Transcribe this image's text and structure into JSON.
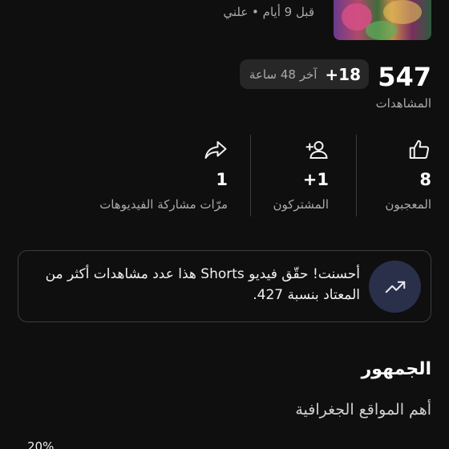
{
  "header": {
    "meta": "قبل 9 أيام • علني",
    "thumbnail": "video-thumbnail"
  },
  "views": {
    "count": "547",
    "label": "المشاهدات",
    "recent_delta": "+18",
    "recent_period": "آخر 48 ساعة"
  },
  "stats": [
    {
      "icon": "thumbs-up-icon",
      "value": "8",
      "label": "المعجبون"
    },
    {
      "icon": "add-subscriber-icon",
      "value": "+1",
      "label": "المشتركون"
    },
    {
      "icon": "share-icon",
      "value": "1",
      "label": "مرّات مشاركة الفيديوهات"
    }
  ],
  "insight": {
    "icon": "trending-up-icon",
    "text": "أحسنت! حقّق فيديو Shorts هذا عدد مشاهدات أكثر من المعتاد بنسبة 427."
  },
  "audience": {
    "title": "الجمهور",
    "subtitle": "أهم المواقع الجغرافية",
    "first_row_percent": "20%"
  },
  "colors": {
    "background": "#0f0f0f",
    "chip": "#272727",
    "insight_badge": "#2a2f4a",
    "secondary_text": "#aaaaaa"
  }
}
